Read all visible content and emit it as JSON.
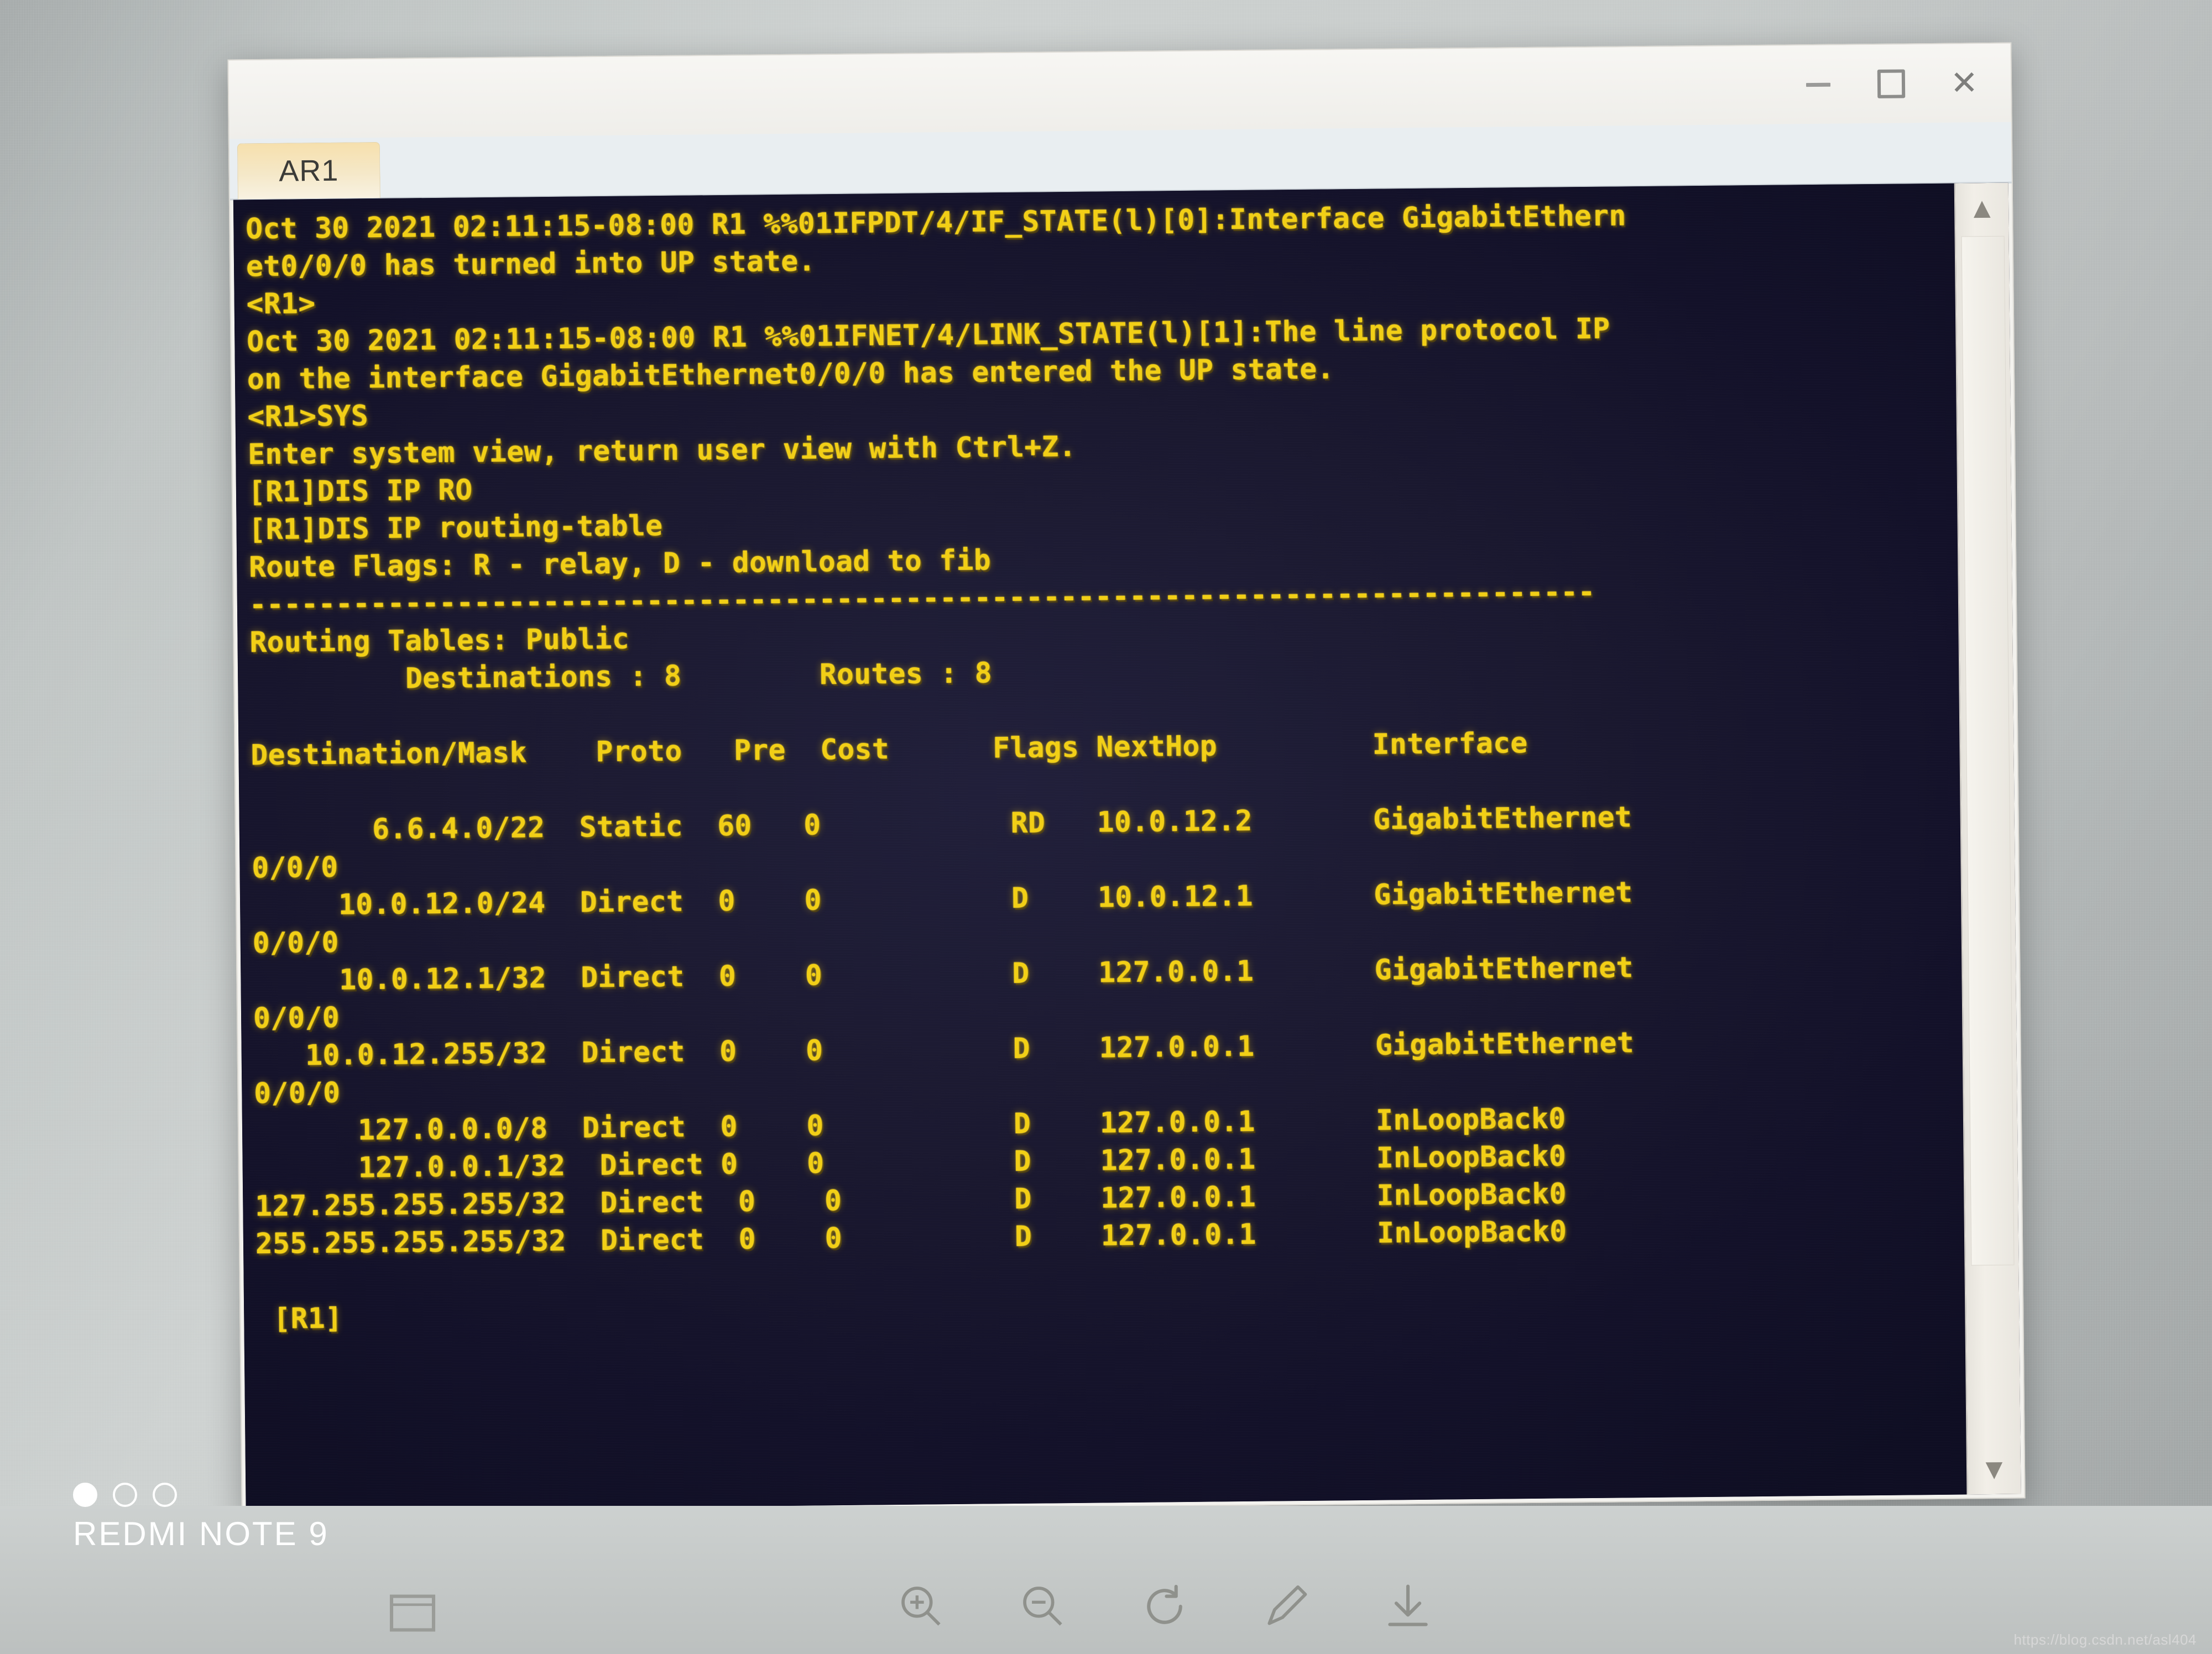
{
  "window": {
    "controls": {
      "minimize_label": "minimize",
      "maximize_label": "maximize",
      "close_label": "close"
    }
  },
  "tabs": [
    {
      "label": "AR1",
      "active": true
    }
  ],
  "terminal": {
    "prompt_final": "[R1]",
    "text": "Oct 30 2021 02:11:15-08:00 R1 %%01IFPDT/4/IF_STATE(l)[0]:Interface GigabitEthern\net0/0/0 has turned into UP state.\n<R1>\nOct 30 2021 02:11:15-08:00 R1 %%01IFNET/4/LINK_STATE(l)[1]:The line protocol IP\non the interface GigabitEthernet0/0/0 has entered the UP state.\n<R1>SYS\nEnter system view, return user view with Ctrl+Z.\n[R1]DIS IP RO\n[R1]DIS IP routing-table\nRoute Flags: R - relay, D - download to fib\n------------------------------------------------------------------------------\nRouting Tables: Public\n         Destinations : 8        Routes : 8\n\nDestination/Mask    Proto   Pre  Cost      Flags NextHop         Interface\n\n       6.6.4.0/22  Static  60   0           RD   10.0.12.2       GigabitEthernet\n0/0/0\n     10.0.12.0/24  Direct  0    0           D    10.0.12.1       GigabitEthernet\n0/0/0\n     10.0.12.1/32  Direct  0    0           D    127.0.0.1       GigabitEthernet\n0/0/0\n   10.0.12.255/32  Direct  0    0           D    127.0.0.1       GigabitEthernet\n0/0/0\n      127.0.0.0/8  Direct  0    0           D    127.0.0.1       InLoopBack0\n      127.0.0.1/32  Direct 0    0           D    127.0.0.1       InLoopBack0\n127.255.255.255/32  Direct  0    0          D    127.0.0.1       InLoopBack0\n255.255.255.255/32  Direct  0    0          D    127.0.0.1       InLoopBack0\n\n [R1]",
    "colors": {
      "foreground": "#f2cf16",
      "background": "#18162e"
    }
  },
  "routing_table": {
    "flags_legend": "Route Flags: R - relay, D - download to fib",
    "tables_name": "Routing Tables: Public",
    "destinations_label": "Destinations",
    "destinations_count": "8",
    "routes_label": "Routes",
    "routes_count": "8",
    "columns": [
      "Destination/Mask",
      "Proto",
      "Pre",
      "Cost",
      "Flags",
      "NextHop",
      "Interface"
    ],
    "rows": [
      {
        "destination": "6.6.4.0/22",
        "proto": "Static",
        "pre": "60",
        "cost": "0",
        "flags": "RD",
        "nexthop": "10.0.12.2",
        "interface": "GigabitEthernet0/0/0"
      },
      {
        "destination": "10.0.12.0/24",
        "proto": "Direct",
        "pre": "0",
        "cost": "0",
        "flags": "D",
        "nexthop": "10.0.12.1",
        "interface": "GigabitEthernet0/0/0"
      },
      {
        "destination": "10.0.12.1/32",
        "proto": "Direct",
        "pre": "0",
        "cost": "0",
        "flags": "D",
        "nexthop": "127.0.0.1",
        "interface": "GigabitEthernet0/0/0"
      },
      {
        "destination": "10.0.12.255/32",
        "proto": "Direct",
        "pre": "0",
        "cost": "0",
        "flags": "D",
        "nexthop": "127.0.0.1",
        "interface": "GigabitEthernet0/0/0"
      },
      {
        "destination": "127.0.0.0/8",
        "proto": "Direct",
        "pre": "0",
        "cost": "0",
        "flags": "D",
        "nexthop": "127.0.0.1",
        "interface": "InLoopBack0"
      },
      {
        "destination": "127.0.0.1/32",
        "proto": "Direct",
        "pre": "0",
        "cost": "0",
        "flags": "D",
        "nexthop": "127.0.0.1",
        "interface": "InLoopBack0"
      },
      {
        "destination": "127.255.255.255/32",
        "proto": "Direct",
        "pre": "0",
        "cost": "0",
        "flags": "D",
        "nexthop": "127.0.0.1",
        "interface": "InLoopBack0"
      },
      {
        "destination": "255.255.255.255/32",
        "proto": "Direct",
        "pre": "0",
        "cost": "0",
        "flags": "D",
        "nexthop": "127.0.0.1",
        "interface": "InLoopBack0"
      }
    ]
  },
  "log_messages": [
    "Oct 30 2021 02:11:15-08:00 R1 %%01IFPDT/4/IF_STATE(l)[0]:Interface GigabitEthernet0/0/0 has turned into UP state.",
    "Oct 30 2021 02:11:15-08:00 R1 %%01IFNET/4/LINK_STATE(l)[1]:The line protocol IP on the interface GigabitEthernet0/0/0 has entered the UP state."
  ],
  "commands": [
    "<R1>SYS",
    "Enter system view, return user view with Ctrl+Z.",
    "[R1]DIS IP RO",
    "[R1]DIS IP routing-table"
  ],
  "toolbar": {
    "items": [
      {
        "icon": "zoom-in-icon",
        "label": "Zoom In"
      },
      {
        "icon": "zoom-out-icon",
        "label": "Zoom Out"
      },
      {
        "icon": "refresh-icon",
        "label": "Refresh"
      },
      {
        "icon": "edit-icon",
        "label": "Edit"
      },
      {
        "icon": "download-icon",
        "label": "Download"
      }
    ]
  },
  "watermark": {
    "device": "REDMI NOTE 9",
    "url": "https://blog.csdn.net/asl404"
  }
}
